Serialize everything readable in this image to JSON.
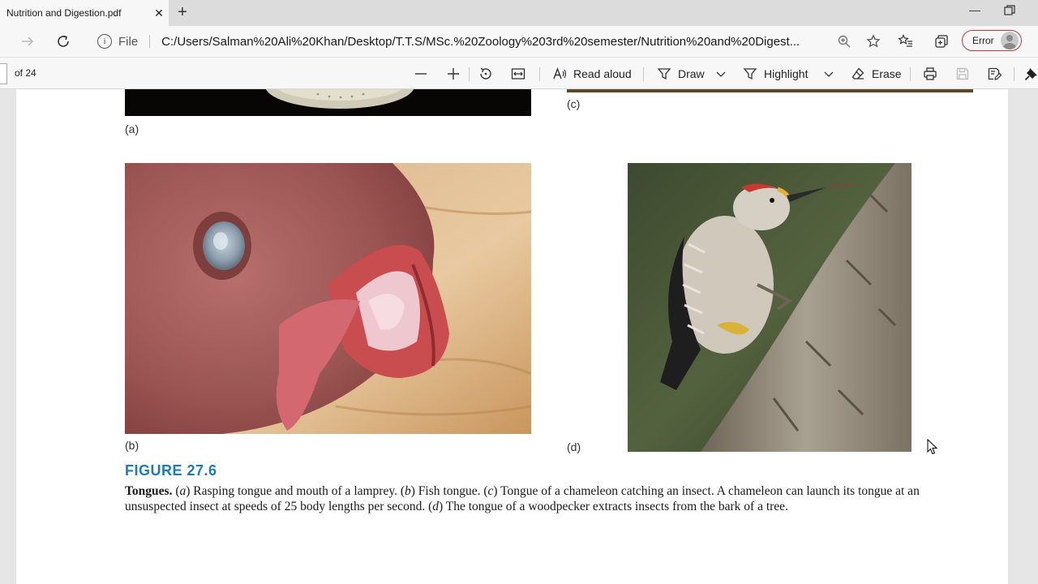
{
  "browser": {
    "tab_title": "Nutrition and Digestion.pdf",
    "tab_close": "✕",
    "new_tab": "+",
    "minimize": "—",
    "file_label": "File",
    "url": "C:/Users/Salman%20Ali%20Khan/Desktop/T.T.S/MSc.%20Zoology%203rd%20semester/Nutrition%20and%20Digest...",
    "profile_label": "Error"
  },
  "pdf_toolbar": {
    "page_of": "of 24",
    "read_aloud": "Read aloud",
    "draw": "Draw",
    "highlight": "Highlight",
    "erase": "Erase"
  },
  "figure": {
    "caption_a": "(a)",
    "caption_b": "(b)",
    "caption_c": "(c)",
    "caption_d": "(d)",
    "label": "FIGURE 27.6",
    "title": "Tongues.",
    "text_1": " (",
    "a": "a",
    "text_2": ") Rasping tongue and mouth of a lamprey. (",
    "b": "b",
    "text_3": ") Fish tongue. (",
    "c": "c",
    "text_4": ") Tongue of a chameleon catching an insect. A chameleon can launch its tongue at an unsuspected insect at speeds of 25 body lengths per second. (",
    "d": "d",
    "text_5": ") The tongue of a woodpecker extracts insects from the bark of a tree."
  },
  "colors": {
    "figure_label": "#1f7ab8",
    "profile_border": "#c23b3b"
  },
  "icons": {
    "back": "arrow-right-icon",
    "refresh": "refresh-icon",
    "info": "info-icon",
    "zoom": "zoom-icon",
    "favorite": "star-icon",
    "favorites": "favorites-list-icon",
    "collections": "collections-icon"
  }
}
